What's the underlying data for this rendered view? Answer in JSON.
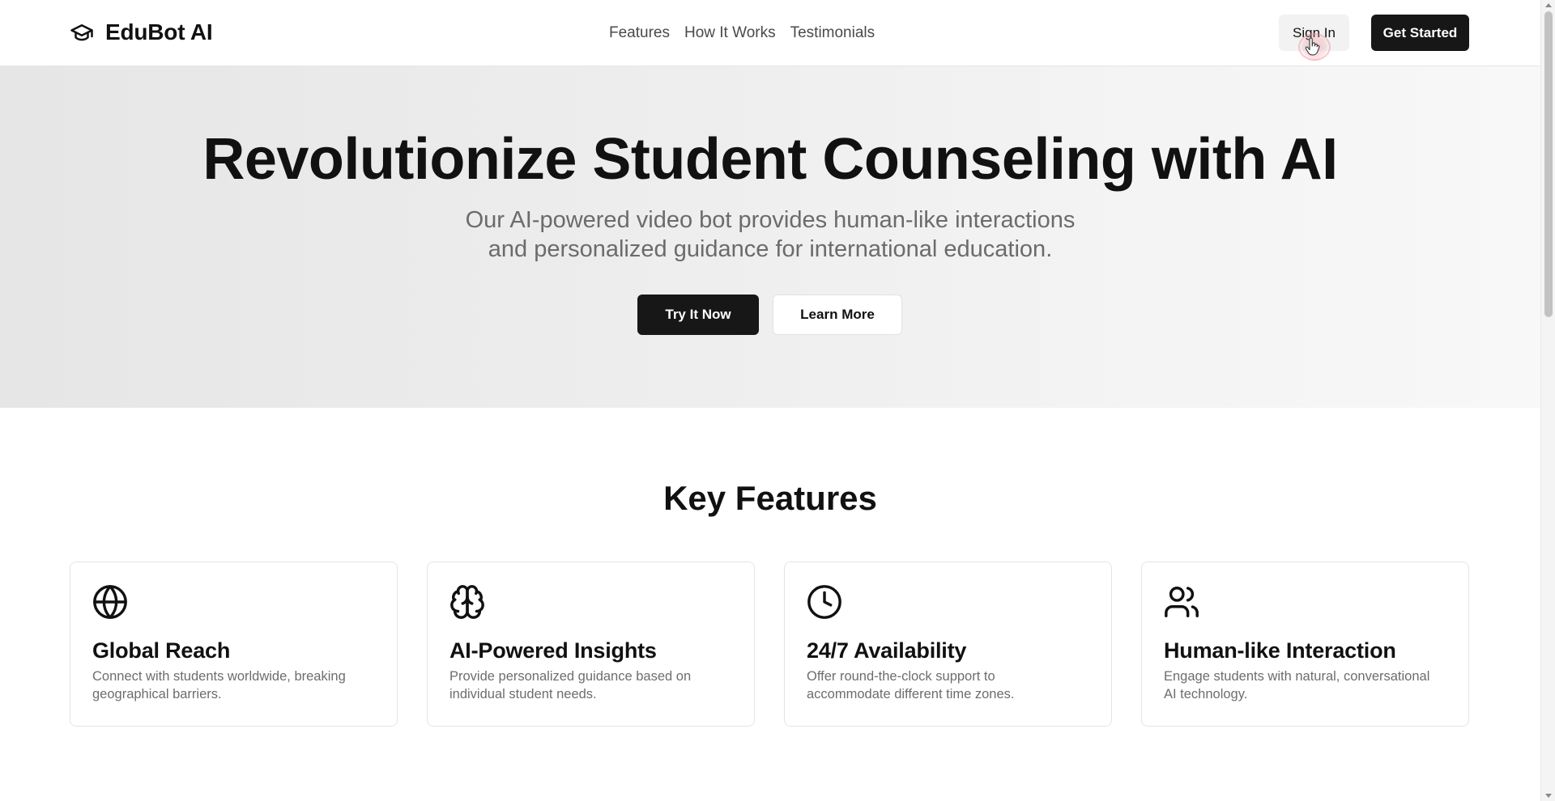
{
  "header": {
    "brand_name": "EduBot AI",
    "brand_icon": "graduation-cap-icon",
    "nav": [
      {
        "label": "Features"
      },
      {
        "label": "How It Works"
      },
      {
        "label": "Testimonials"
      }
    ],
    "sign_in_label": "Sign In",
    "get_started_label": "Get Started"
  },
  "hero": {
    "title": "Revolutionize Student Counseling with AI",
    "subtitle_line1": "Our AI-powered video bot provides human-like interactions",
    "subtitle_line2": "and personalized guidance for international education.",
    "primary_cta": "Try It Now",
    "secondary_cta": "Learn More"
  },
  "features": {
    "title": "Key Features",
    "items": [
      {
        "icon": "globe-icon",
        "title": "Global Reach",
        "desc_line1": "Connect with students worldwide, breaking",
        "desc_line2": "geographical barriers."
      },
      {
        "icon": "brain-icon",
        "title": "AI-Powered Insights",
        "desc_line1": "Provide personalized guidance based on",
        "desc_line2": "individual student needs."
      },
      {
        "icon": "clock-icon",
        "title": "24/7 Availability",
        "desc_line1": "Offer round-the-clock support to",
        "desc_line2": "accommodate different time zones."
      },
      {
        "icon": "users-icon",
        "title": "Human-like Interaction",
        "desc_line1": "Engage students with natural, conversational",
        "desc_line2": "AI technology."
      }
    ]
  },
  "colors": {
    "primary_button": "#171717",
    "text": "#111111",
    "muted_text": "#6b6b6b",
    "hero_bg": "#ececec"
  }
}
